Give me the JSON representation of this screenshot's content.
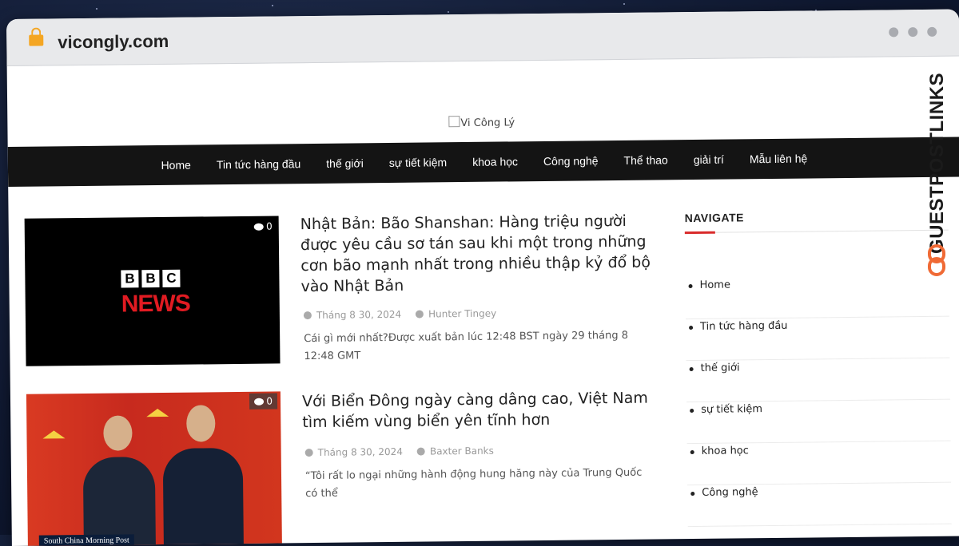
{
  "browser": {
    "url": "vicongly.com"
  },
  "site": {
    "logo_alt": "Vi Công Lý"
  },
  "nav": {
    "items": [
      "Home",
      "Tin tức hàng đầu",
      "thế giới",
      "sự tiết kiệm",
      "khoa học",
      "Công nghệ",
      "Thể thao",
      "giải trí",
      "Mẫu liên hệ"
    ]
  },
  "posts": [
    {
      "title": "Nhật Bản: Bão Shanshan: Hàng triệu người được yêu cầu sơ tán sau khi một trong những cơn bão mạnh nhất trong nhiều thập kỷ đổ bộ vào Nhật Bản",
      "date": "Tháng 8 30, 2024",
      "author": "Hunter Tingey",
      "excerpt": "Cái gì mới nhất?Được xuất bản lúc 12:48 BST ngày 29 tháng 8 12:48 GMT",
      "comments": "0",
      "thumb_text": {
        "bbc": [
          "B",
          "B",
          "C"
        ],
        "news": "NEWS"
      }
    },
    {
      "title": "Với Biển Đông ngày càng dâng cao, Việt Nam tìm kiếm vùng biển yên tĩnh hơn",
      "date": "Tháng 8 30, 2024",
      "author": "Baxter Banks",
      "excerpt": "“Tôi rất lo ngại những hành động hung hăng này của Trung Quốc có thể",
      "comments": "0",
      "thumb_text": {
        "source": "South China Morning Post"
      }
    }
  ],
  "sidebar": {
    "title": "NAVIGATE",
    "items": [
      "Home",
      "Tin tức hàng đầu",
      "thế giới",
      "sự tiết kiệm",
      "khoa học",
      "Công nghệ"
    ]
  },
  "watermark": {
    "text": "GUESTPOSTLINKS"
  }
}
